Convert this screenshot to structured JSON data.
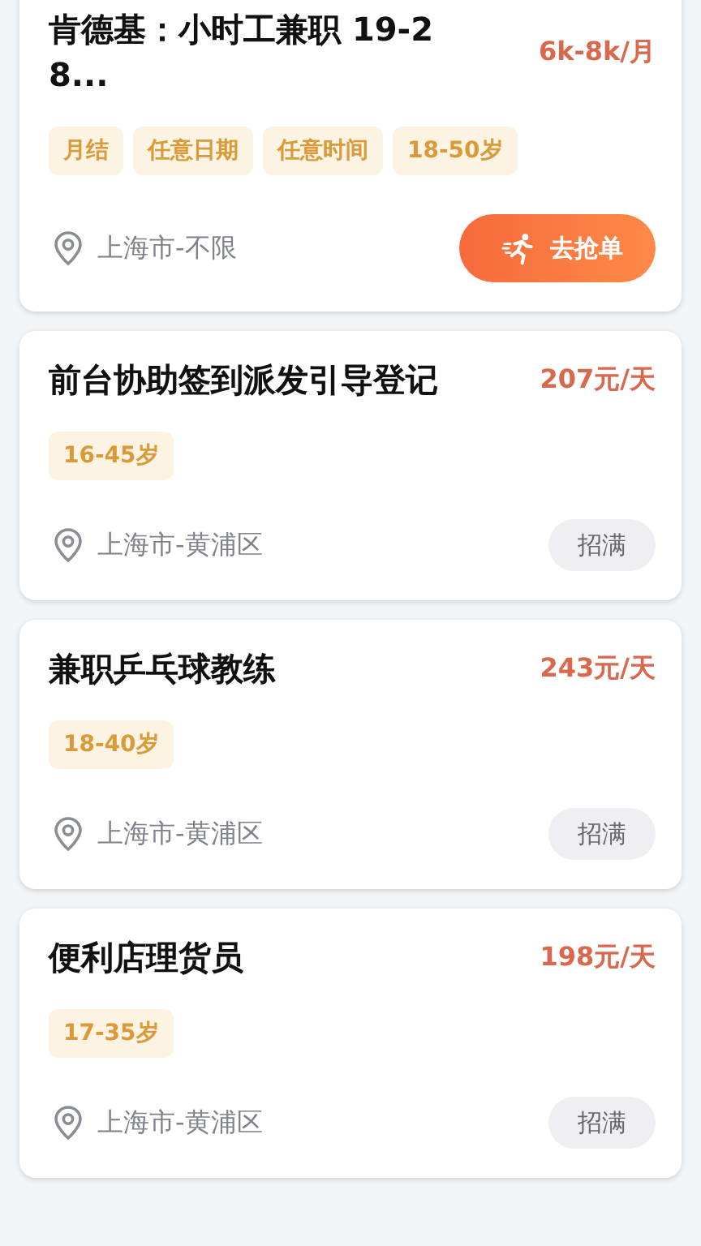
{
  "jobs": [
    {
      "title": "肯德基：小时工兼职 19-28...",
      "pay": "6k-8k/月",
      "tags": [
        "月结",
        "任意日期",
        "任意时间",
        "18-50岁"
      ],
      "location": "上海市-不限",
      "action": {
        "kind": "grab",
        "label": "去抢单"
      }
    },
    {
      "title": "前台协助签到派发引导登记",
      "pay": "207元/天",
      "tags": [
        "16-45岁"
      ],
      "location": "上海市-黄浦区",
      "action": {
        "kind": "full",
        "label": "招满"
      }
    },
    {
      "title": "兼职乒乓球教练",
      "pay": "243元/天",
      "tags": [
        "18-40岁"
      ],
      "location": "上海市-黄浦区",
      "action": {
        "kind": "full",
        "label": "招满"
      }
    },
    {
      "title": "便利店理货员",
      "pay": "198元/天",
      "tags": [
        "17-35岁"
      ],
      "location": "上海市-黄浦区",
      "action": {
        "kind": "full",
        "label": "招满"
      }
    }
  ]
}
